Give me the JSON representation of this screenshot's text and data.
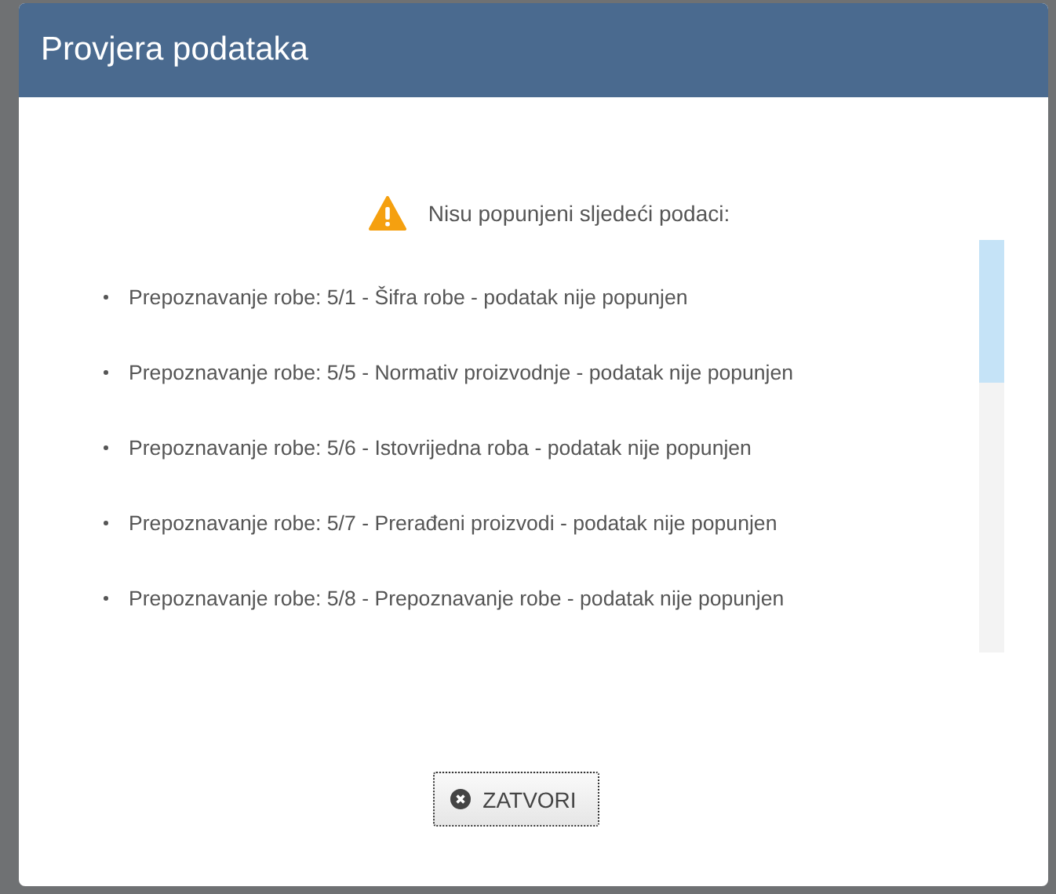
{
  "dialog": {
    "title": "Provjera podataka",
    "warning": "Nisu popunjeni sljedeći podaci:",
    "items": [
      "Prepoznavanje robe: 5/1 - Šifra robe - podatak nije popunjen",
      "Prepoznavanje robe: 5/5 - Normativ proizvodnje - podatak nije popunjen",
      "Prepoznavanje robe: 5/6 - Istovrijedna roba - podatak nije popunjen",
      "Prepoznavanje robe: 5/7 - Prerađeni proizvodi - podatak nije popunjen",
      "Prepoznavanje robe: 5/8 - Prepoznavanje robe - podatak nije popunjen"
    ],
    "button": "ZATVORI"
  }
}
